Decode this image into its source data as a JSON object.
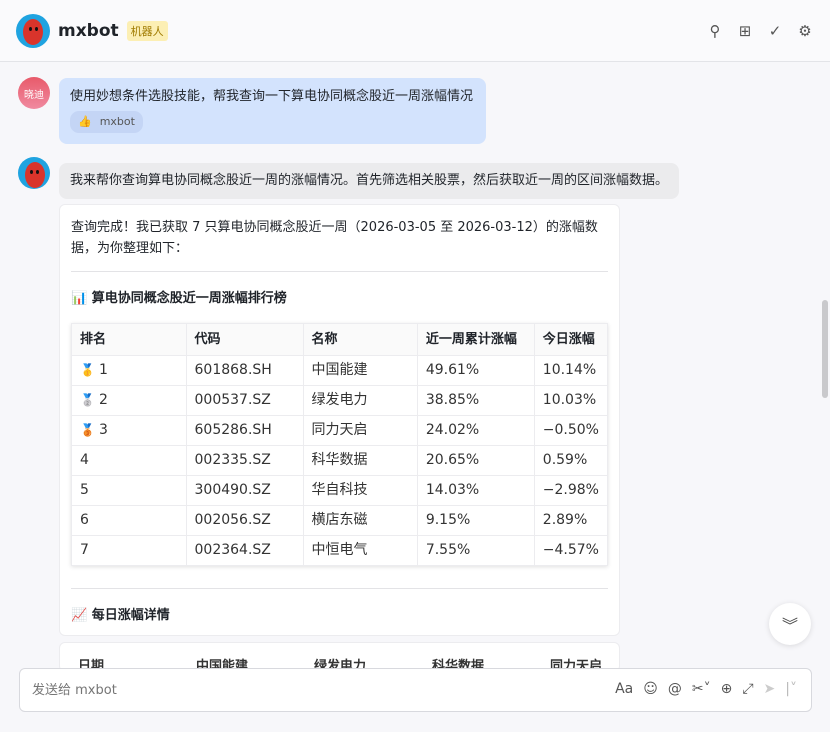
{
  "header": {
    "title": "mxbot",
    "badge": "机器人",
    "icons": [
      "search-icon",
      "add-window-icon",
      "check-edit-icon",
      "gear-icon"
    ]
  },
  "user_message": {
    "avatar_text": "晓迪",
    "text": "使用妙想条件选股技能，帮我查询一下算电协同概念股近一周涨幅情况",
    "chip": "mxbot"
  },
  "bot_message": {
    "text": "我来帮你查询算电协同概念股近一周的涨幅情况。首先筛选相关股票，然后获取近一周的区间涨幅数据。"
  },
  "result": {
    "intro": "查询完成！我已获取 7 只算电协同概念股近一周（2026-03-05 至 2026-03-12）的涨幅数据，为你整理如下：",
    "section1": "📊 算电协同概念股近一周涨幅排行榜",
    "columns": [
      "排名",
      "代码",
      "名称",
      "近一周累计涨幅",
      "今日涨幅"
    ],
    "rows": [
      {
        "rank": "1",
        "medal": "🥇",
        "code": "601868.SH",
        "name": "中国能建",
        "week": "49.61%",
        "today": "10.14%"
      },
      {
        "rank": "2",
        "medal": "🥈",
        "code": "000537.SZ",
        "name": "绿发电力",
        "week": "38.85%",
        "today": "10.03%"
      },
      {
        "rank": "3",
        "medal": "🥉",
        "code": "605286.SH",
        "name": "同力天启",
        "week": "24.02%",
        "today": "−0.50%"
      },
      {
        "rank": "4",
        "medal": "",
        "code": "002335.SZ",
        "name": "科华数据",
        "week": "20.65%",
        "today": "0.59%"
      },
      {
        "rank": "5",
        "medal": "",
        "code": "300490.SZ",
        "name": "华自科技",
        "week": "14.03%",
        "today": "−2.98%"
      },
      {
        "rank": "6",
        "medal": "",
        "code": "002056.SZ",
        "name": "横店东磁",
        "week": "9.15%",
        "today": "2.89%"
      },
      {
        "rank": "7",
        "medal": "",
        "code": "002364.SZ",
        "name": "中恒电气",
        "week": "7.55%",
        "today": "−4.57%"
      }
    ],
    "section2": "📈 每日涨幅详情",
    "daily_columns": [
      "日期",
      "中国能建",
      "绿发电力",
      "科华数据",
      "同力天启"
    ]
  },
  "input": {
    "placeholder": "发送给 mxbot"
  },
  "toolbar": {
    "font": "Aa",
    "emoji": "☺",
    "mention": "@",
    "scissors": "✂˅",
    "add": "⊕",
    "expand": "⤢",
    "send": "➤"
  }
}
